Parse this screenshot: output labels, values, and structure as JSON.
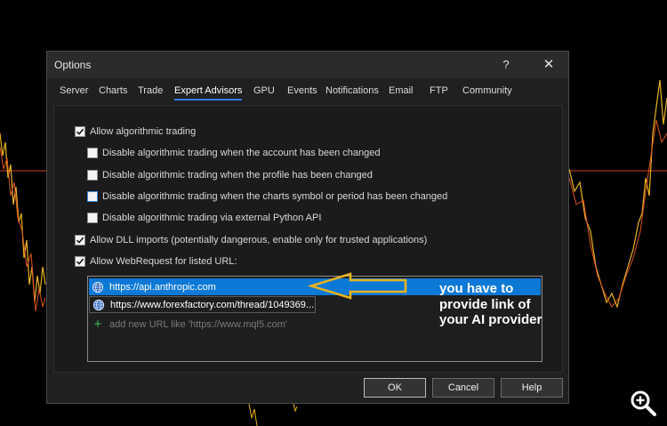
{
  "window": {
    "title": "Options",
    "help_glyph": "?",
    "close_glyph": "✕"
  },
  "tabs": [
    {
      "label": "Server",
      "active": false
    },
    {
      "label": "Charts",
      "active": false
    },
    {
      "label": "Trade",
      "active": false
    },
    {
      "label": "Expert Advisors",
      "active": true
    },
    {
      "label": "GPU",
      "active": false
    },
    {
      "label": "Events",
      "active": false
    },
    {
      "label": "Notifications",
      "active": false
    },
    {
      "label": "Email",
      "active": false
    },
    {
      "label": "FTP",
      "active": false
    },
    {
      "label": "Community",
      "active": false
    }
  ],
  "options": [
    {
      "label": "Allow algorithmic trading",
      "checked": true
    },
    {
      "label": "Disable algorithmic trading when the account has been changed",
      "checked": false
    },
    {
      "label": "Disable algorithmic trading when the profile has been changed",
      "checked": false
    },
    {
      "label": "Disable algorithmic trading when the charts symbol or period has been changed",
      "checked": false
    },
    {
      "label": "Disable algorithmic trading via external Python API",
      "checked": false
    },
    {
      "label": "Allow DLL imports (potentially dangerous, enable only for trusted applications)",
      "checked": true
    },
    {
      "label": "Allow WebRequest for listed URL:",
      "checked": true
    }
  ],
  "url_list": {
    "urls": [
      "https://api.anthropic.com",
      "https://www.forexfactory.com/thread/1049369..."
    ],
    "add_placeholder": "add new URL like 'https://www.mql5.com'"
  },
  "annotation": {
    "lines": [
      "you have to",
      "provide link of",
      "your AI provider"
    ],
    "arrow_color": "#e8b320"
  },
  "buttons": {
    "ok": "OK",
    "cancel": "Cancel",
    "help": "Help"
  },
  "colors": {
    "accent": "#2f7de1",
    "selection": "#0d79d6",
    "add_icon": "#3fbf5b"
  },
  "icons": {
    "globe": "globe-icon",
    "plus": "plus-icon",
    "zoom": "zoom-in-icon",
    "check": "check-icon"
  }
}
